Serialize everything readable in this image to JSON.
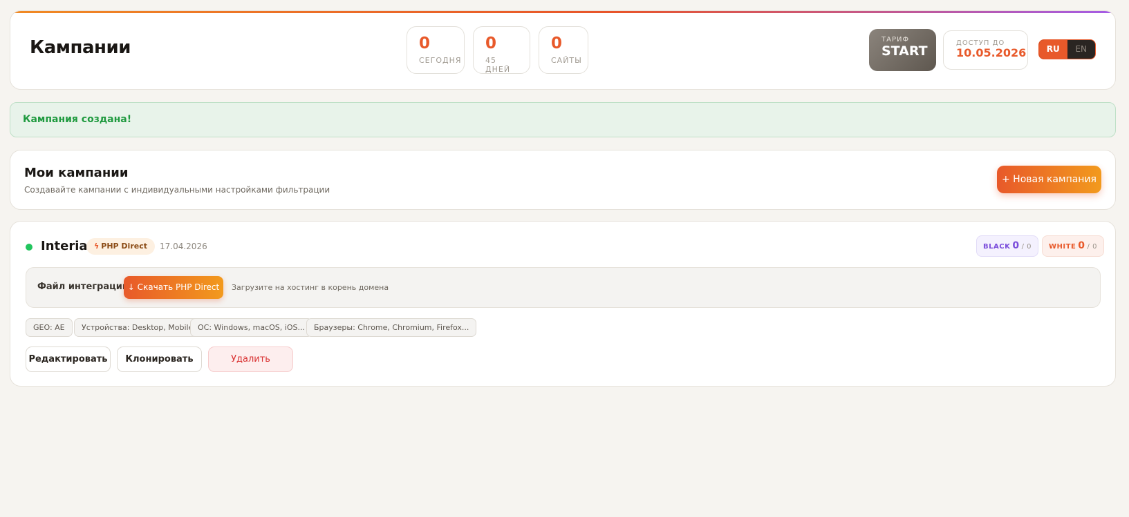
{
  "header": {
    "title": "Кампании",
    "stats": [
      {
        "value": "0",
        "label": "СЕГОДНЯ"
      },
      {
        "value": "0",
        "label": "45 ДНЕЙ"
      },
      {
        "value": "0",
        "label": "САЙТЫ"
      }
    ],
    "tariff": {
      "label": "ТАРИФ",
      "value": "START"
    },
    "access": {
      "label": "ДОСТУП ДО",
      "value": "10.05.2026"
    },
    "lang": {
      "active": "RU",
      "inactive": "EN"
    }
  },
  "alert": {
    "text": "Кампания создана!"
  },
  "my_campaigns": {
    "title": "Мои кампании",
    "subtitle": "Создавайте кампании с индивидуальными настройками фильтрации",
    "new_button": "+ Новая кампания"
  },
  "campaign": {
    "name": "Interia",
    "status_color": "#22c55e",
    "type": "PHP Direct",
    "type_icon": "bolt-icon",
    "date": "17.04.2026",
    "black": {
      "label": "BLACK",
      "value": "0",
      "total": "/ 0"
    },
    "white": {
      "label": "WHITE",
      "value": "0",
      "total": "/ 0"
    },
    "integration": {
      "label": "Файл интеграции:",
      "button": "↓ Скачать PHP Direct",
      "hint": "Загрузите на хостинг в корень домена"
    },
    "tags": [
      "GEO: AE",
      "Устройства: Desktop, Mobile",
      "ОС: Windows, macOS, iOS...",
      "Браузеры: Chrome, Chromium, Firefox..."
    ],
    "actions": {
      "edit": "Редактировать",
      "clone": "Клонировать",
      "delete": "Удалить"
    }
  },
  "colors": {
    "accent": "#e8592a",
    "accent_2": "#f29a1d",
    "success": "#1f9a3f",
    "black_badge": "#7b4ddb"
  }
}
